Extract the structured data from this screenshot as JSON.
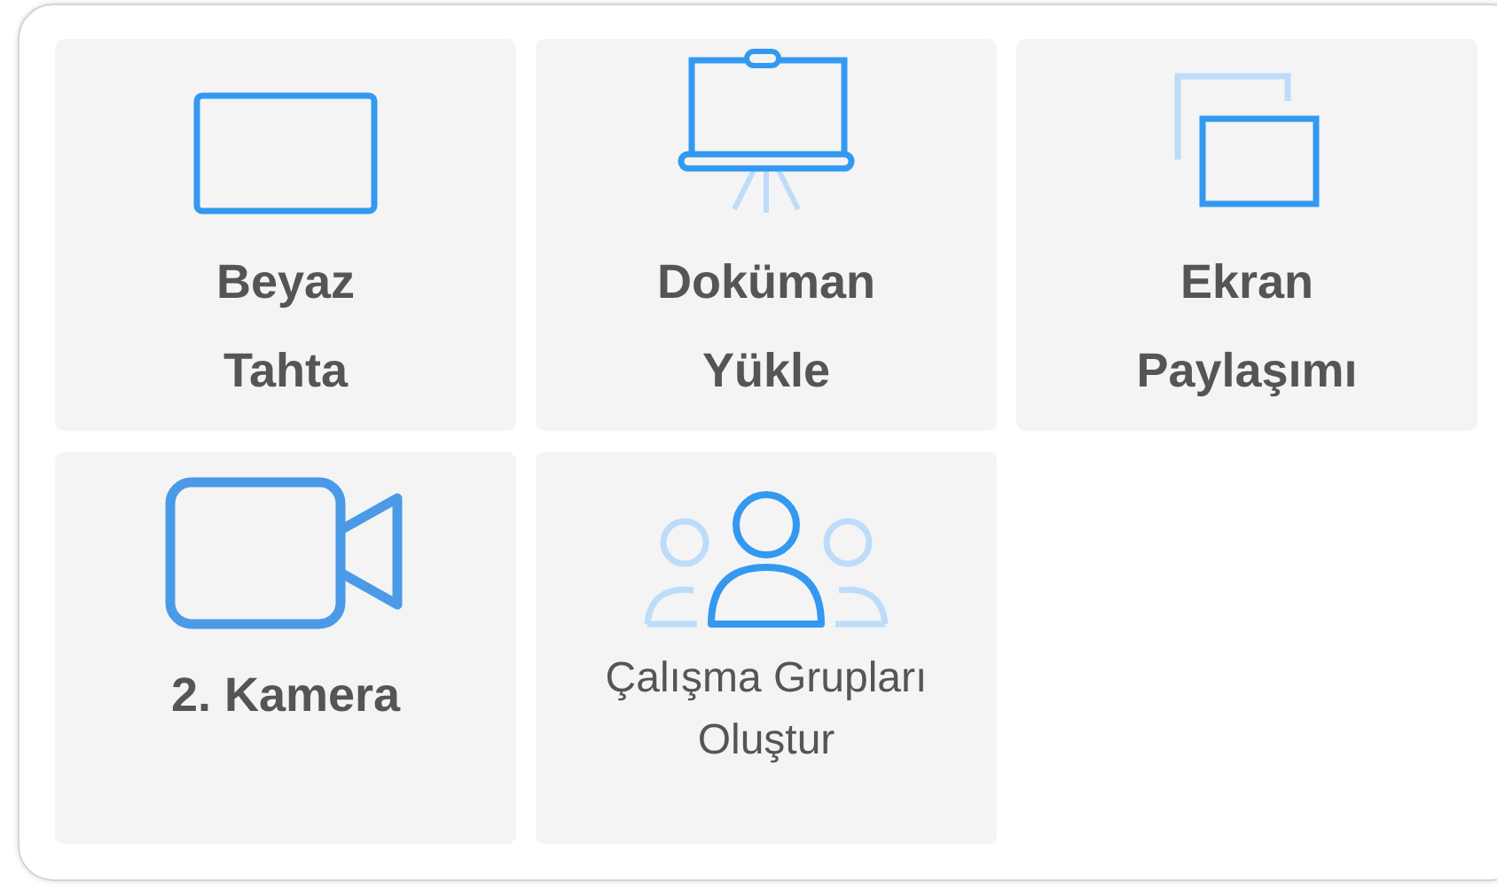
{
  "tiles": [
    {
      "kind": "whiteboard",
      "label": "Beyaz\nTahta"
    },
    {
      "kind": "presentation",
      "label": "Doküman\nYükle"
    },
    {
      "kind": "screen-share",
      "label": "Ekran\nPaylaşımı"
    },
    {
      "kind": "camera",
      "label": "2. Kamera"
    },
    {
      "kind": "group",
      "label": "Çalışma Grupları\nOluştur"
    }
  ]
}
